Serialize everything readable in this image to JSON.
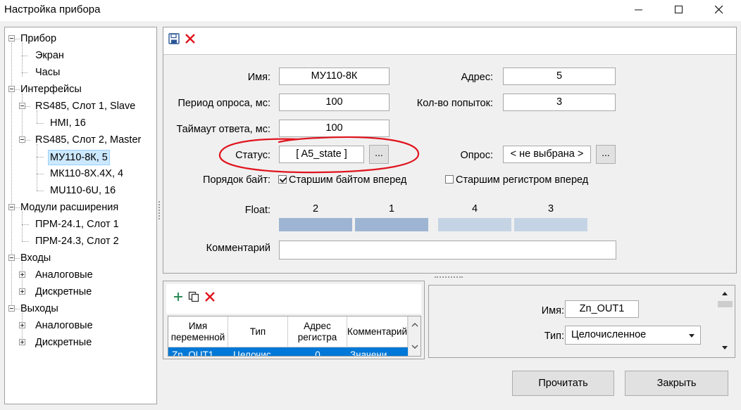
{
  "window": {
    "title": "Настройка прибора",
    "minimize_glyph": "—",
    "maximize_glyph": "☐",
    "close_glyph": "✕"
  },
  "tree": {
    "items": [
      {
        "label": "Прибор"
      },
      {
        "label": "Экран"
      },
      {
        "label": "Часы"
      },
      {
        "label": "Интерфейсы"
      },
      {
        "label": "RS485, Слот 1, Slave"
      },
      {
        "label": "HMI, 16"
      },
      {
        "label": "RS485, Слот 2, Master"
      },
      {
        "label": "МУ110-8К, 5"
      },
      {
        "label": "МК110-8Х.4Х, 4"
      },
      {
        "label": "MU110-6U, 16"
      },
      {
        "label": "Модули расширения"
      },
      {
        "label": "ПРМ-24.1, Слот 1"
      },
      {
        "label": "ПРМ-24.3, Слот 2"
      },
      {
        "label": "Входы"
      },
      {
        "label": "Аналоговые"
      },
      {
        "label": "Дискретные"
      },
      {
        "label": "Выходы"
      },
      {
        "label": "Аналоговые"
      },
      {
        "label": "Дискретные"
      }
    ]
  },
  "settings": {
    "toolbar": {
      "save_icon": "save-icon",
      "delete_icon": "delete-icon"
    },
    "name_label": "Имя:",
    "name_value": "МУ110-8К",
    "address_label": "Адрес:",
    "address_value": "5",
    "poll_period_label": "Период опроса, мс:",
    "poll_period_value": "100",
    "retries_label": "Кол-во попыток:",
    "retries_value": "3",
    "timeout_label": "Таймаут ответа, мс:",
    "timeout_value": "100",
    "status_label": "Статус:",
    "status_value": "[ A5_state ]",
    "status_button": "...",
    "poll_label": "Опрос:",
    "poll_value": "< не выбрана >",
    "poll_button": "...",
    "byte_order_label": "Порядок байт:",
    "high_byte_first_label": "Старшим байтом вперед",
    "high_byte_first_checked": true,
    "high_register_first_label": "Старшим регистром вперед",
    "high_register_first_checked": false,
    "float_label": "Float:",
    "float_order": [
      {
        "label": "2",
        "color": "#9db5d2"
      },
      {
        "label": "1",
        "color": "#9db5d2"
      },
      {
        "label": "4",
        "color": "#c5d4e4"
      },
      {
        "label": "3",
        "color": "#c5d4e4"
      }
    ],
    "comment_label": "Комментарий",
    "comment_value": "",
    "annotation_color": "#e0141e"
  },
  "variables": {
    "toolbar": {
      "add_icon": "add-icon",
      "copy_icon": "copy-icon",
      "delete_icon": "delete-icon"
    },
    "columns": [
      "Имя\nпеременной",
      "Тип",
      "Адрес\nрегистра",
      "Комментарий"
    ],
    "rows": [
      {
        "name": "Zn_OUT1",
        "type": "Целочис",
        "address": "0",
        "comment": "Значени"
      }
    ]
  },
  "detail": {
    "name_label": "Имя:",
    "name_value": "Zn_OUT1",
    "type_label": "Тип:",
    "type_value": "Целочисленное"
  },
  "buttons": {
    "read": "Прочитать",
    "close": "Закрыть"
  },
  "colors": {
    "selection": "#0078d7",
    "tree_selection": "#cce8ff",
    "add_green": "#2e8b57",
    "delete_red": "#e0141e"
  }
}
